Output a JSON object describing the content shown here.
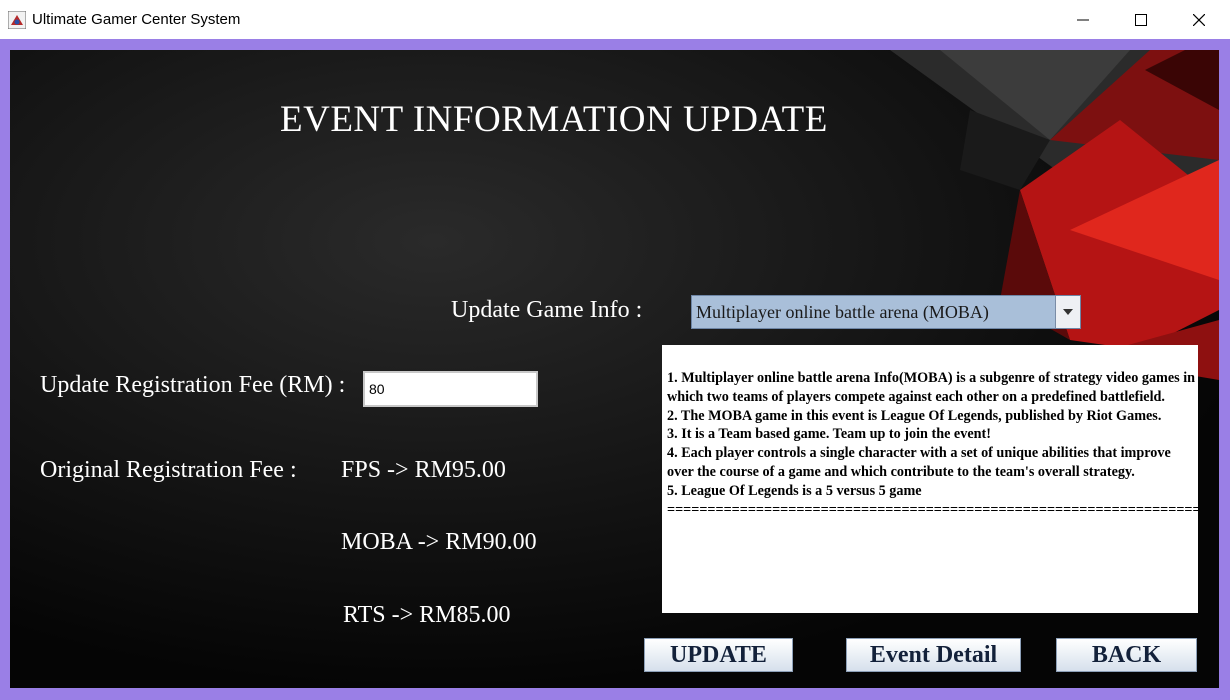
{
  "window": {
    "title": "Ultimate Gamer Center System"
  },
  "page": {
    "heading": "EVENT INFORMATION UPDATE"
  },
  "game_info": {
    "label": "Update Game Info :",
    "selected": "Multiplayer online battle arena (MOBA)"
  },
  "registration": {
    "label": "Update Registration Fee (RM) :",
    "value": "80"
  },
  "original_fee": {
    "label": "Original Registration Fee :",
    "fps": "FPS -> RM95.00",
    "moba": "MOBA -> RM90.00",
    "rts": "RTS -> RM85.00"
  },
  "info_text": "1. Multiplayer online battle arena Info(MOBA) is a subgenre of strategy video games in which two teams of players compete against each other on a predefined battlefield.\n2. The MOBA game in this event is League Of Legends, published by Riot Games.\n3. It is a Team based game. Team up to join the event!\n4. Each player controls a single character with a set of unique abilities that improve over the course of a game and which contribute to the team's overall strategy.\n5. League Of Legends is a 5 versus 5 game\n==========================================================================",
  "buttons": {
    "update": "UPDATE",
    "event_detail": "Event Detail",
    "back": "BACK"
  }
}
